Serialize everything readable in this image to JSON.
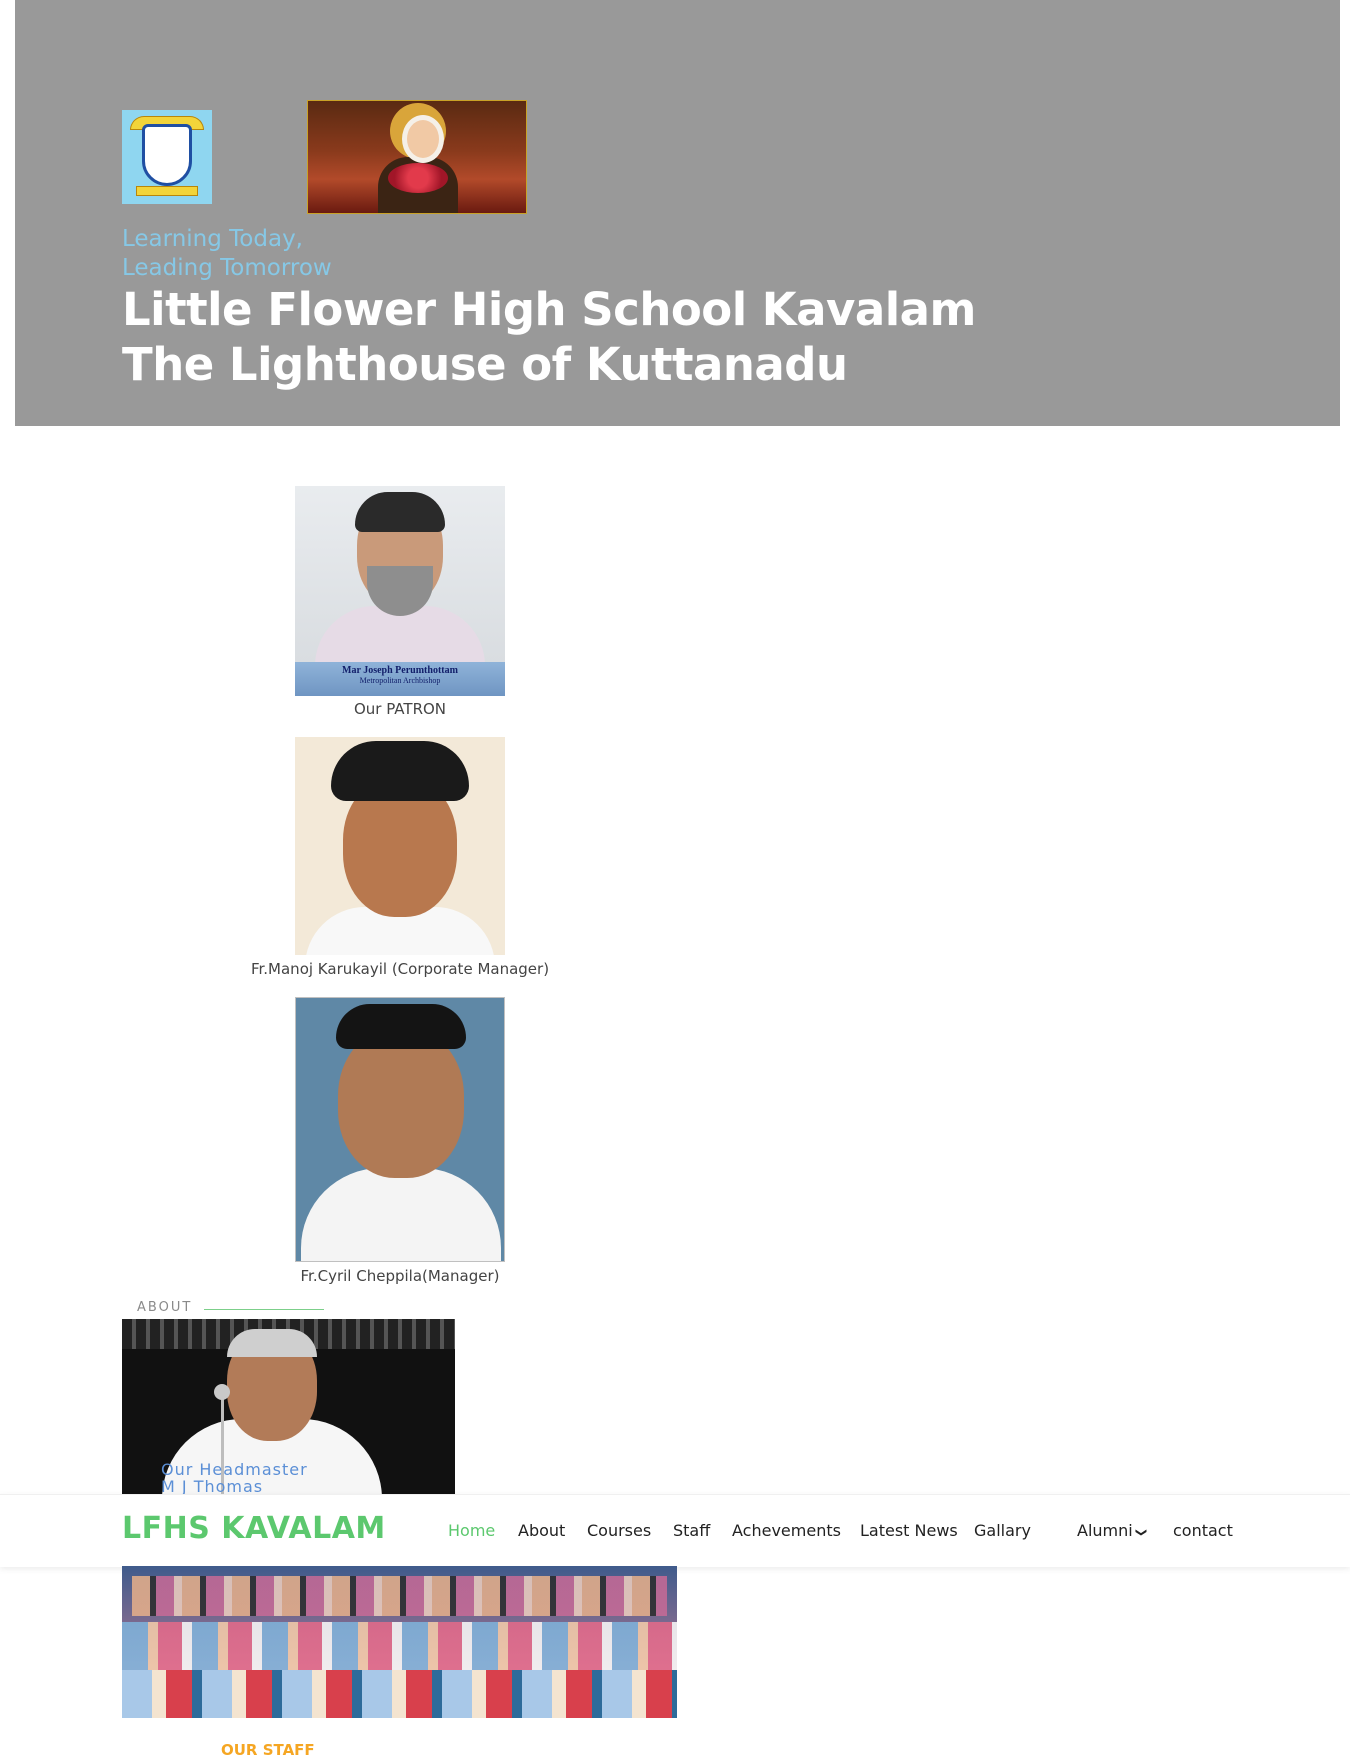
{
  "hero": {
    "tagline_line1": "Learning Today,",
    "tagline_line2": "Leading Tomorrow",
    "title_line1": "Little Flower High School Kavalam",
    "title_line2": "The Lighthouse of Kuttanadu",
    "background_color": "#999999",
    "tagline_color": "#86c8e6"
  },
  "leaders": [
    {
      "caption": "Our PATRON",
      "photo_caption_name": "Mar Joseph Perumthottam",
      "photo_caption_role": "Metropolitan Archbishop"
    },
    {
      "caption": "Fr.Manoj Karukayil (Corporate Manager)"
    },
    {
      "caption": "Fr.Cyril Cheppila(Manager)"
    }
  ],
  "about": {
    "label": "ABOUT",
    "headmaster_title": "Our Headmaster",
    "headmaster_name": "M J Thomas"
  },
  "navbar": {
    "brand": "LFHS KAVALAM",
    "brand_color": "#5cc86e",
    "items": [
      {
        "label": "Home",
        "active": true
      },
      {
        "label": "About"
      },
      {
        "label": "Courses"
      },
      {
        "label": "Staff"
      },
      {
        "label": "Achevements"
      },
      {
        "label": "Latest News"
      },
      {
        "label": "Gallary"
      },
      {
        "label": "Alumni",
        "dropdown": true,
        "icon": "chevron-down-icon"
      },
      {
        "label": "contact"
      }
    ]
  },
  "staff": {
    "title": "OUR STAFF",
    "title_color": "#f5a623"
  }
}
